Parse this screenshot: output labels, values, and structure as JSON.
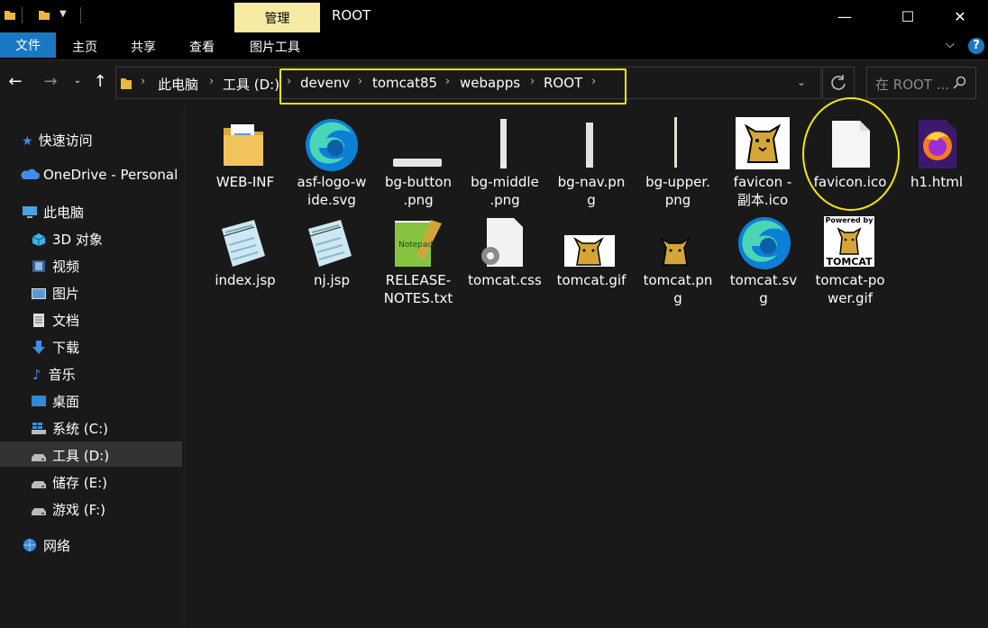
{
  "titlebar": {
    "context_tab": "管理",
    "title": "ROOT",
    "minimize": "—",
    "maximize": "☐",
    "close": "✕"
  },
  "ribbon": {
    "file": "文件",
    "tabs": [
      "主页",
      "共享",
      "查看",
      "图片工具"
    ]
  },
  "address": {
    "crumbs": [
      "此电脑",
      "工具 (D:)",
      "devenv",
      "tomcat85",
      "webapps",
      "ROOT"
    ],
    "search_placeholder": "在 ROOT ..."
  },
  "sidebar": {
    "items": [
      {
        "label": "快速访问",
        "icon": "star-icon"
      },
      {
        "label": "OneDrive - Personal",
        "icon": "cloud-icon"
      },
      {
        "label": "此电脑",
        "icon": "computer-icon"
      },
      {
        "label": "3D 对象",
        "icon": "cube-icon"
      },
      {
        "label": "视频",
        "icon": "film-icon"
      },
      {
        "label": "图片",
        "icon": "picture-icon"
      },
      {
        "label": "文档",
        "icon": "document-icon"
      },
      {
        "label": "下载",
        "icon": "download-icon"
      },
      {
        "label": "音乐",
        "icon": "music-icon"
      },
      {
        "label": "桌面",
        "icon": "desktop-icon"
      },
      {
        "label": "系统 (C:)",
        "icon": "drive-icon"
      },
      {
        "label": "工具 (D:)",
        "icon": "drive-icon"
      },
      {
        "label": "储存 (E:)",
        "icon": "drive-icon"
      },
      {
        "label": "游戏 (F:)",
        "icon": "drive-icon"
      },
      {
        "label": "网络",
        "icon": "network-icon"
      }
    ]
  },
  "files": [
    {
      "l1": "WEB-INF",
      "l2": "",
      "icon": "folder-icon"
    },
    {
      "l1": "asf-logo-w",
      "l2": "ide.svg",
      "icon": "edge-icon"
    },
    {
      "l1": "bg-button",
      "l2": ".png",
      "icon": "image-icon"
    },
    {
      "l1": "bg-middle",
      "l2": ".png",
      "icon": "image-icon"
    },
    {
      "l1": "bg-nav.pn",
      "l2": "g",
      "icon": "image-icon"
    },
    {
      "l1": "bg-upper.",
      "l2": "png",
      "icon": "image-icon"
    },
    {
      "l1": "favicon -",
      "l2": "副本.ico",
      "icon": "tomcat-icon"
    },
    {
      "l1": "favicon.ico",
      "l2": "",
      "icon": "blank-file-icon"
    },
    {
      "l1": "h1.html",
      "l2": "",
      "icon": "firefox-icon"
    },
    {
      "l1": "index.jsp",
      "l2": "",
      "icon": "notepad-icon"
    },
    {
      "l1": "nj.jsp",
      "l2": "",
      "icon": "notepad-icon"
    },
    {
      "l1": "RELEASE-",
      "l2": "NOTES.txt",
      "icon": "notepad-plus-icon"
    },
    {
      "l1": "tomcat.css",
      "l2": "",
      "icon": "css-file-icon"
    },
    {
      "l1": "tomcat.gif",
      "l2": "",
      "icon": "tomcat-icon"
    },
    {
      "l1": "tomcat.pn",
      "l2": "g",
      "icon": "tomcat-icon"
    },
    {
      "l1": "tomcat.sv",
      "l2": "g",
      "icon": "edge-icon"
    },
    {
      "l1": "tomcat-po",
      "l2": "wer.gif",
      "icon": "tomcat-power-icon"
    }
  ],
  "tomcat_power": {
    "top": "Powered by",
    "bottom": "TOMCAT"
  },
  "colors": {
    "accent": "#1a78c2",
    "highlight": "#f5e70a",
    "context_tab": "#f7eba3"
  }
}
